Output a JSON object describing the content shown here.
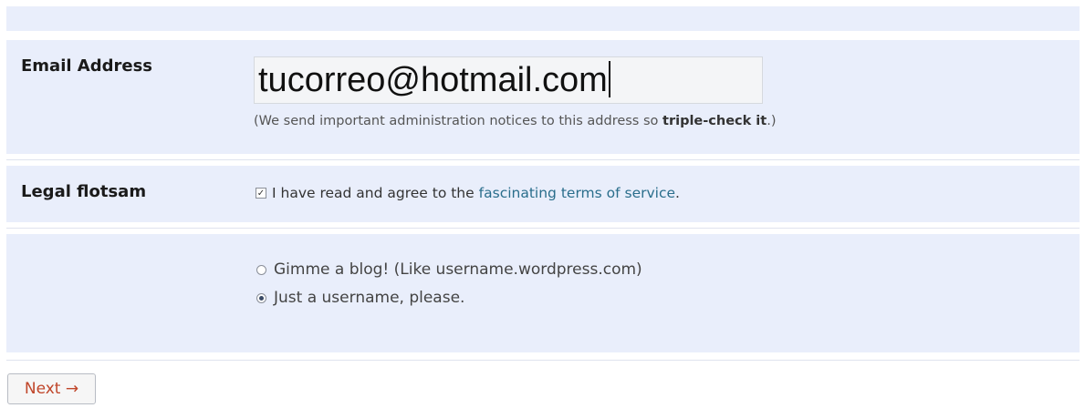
{
  "email": {
    "label": "Email Address",
    "value": "tucorreo@hotmail.com",
    "hint_prefix": "(We send important administration notices to this address so ",
    "hint_bold": "triple-check it",
    "hint_suffix": ".)"
  },
  "legal": {
    "label": "Legal flotsam",
    "checkbox_checked": true,
    "agree_text": "I have read and agree to the",
    "link_text": "fascinating terms of service",
    "suffix": "."
  },
  "signup_type": {
    "options": [
      {
        "label": "Gimme a blog! (Like username.wordpress.com)",
        "selected": false
      },
      {
        "label": "Just a username, please.",
        "selected": true
      }
    ]
  },
  "next_button": {
    "label": "Next →"
  },
  "colors": {
    "band": "#e9eefb",
    "link": "#2a6e8c",
    "next_text": "#c0462a"
  }
}
